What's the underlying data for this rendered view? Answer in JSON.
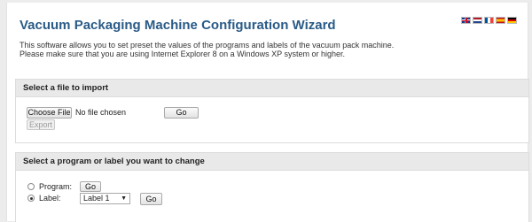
{
  "header": {
    "title": "Vacuum Packaging Machine Configuration Wizard",
    "languages": [
      "English",
      "Dutch",
      "French",
      "Spanish",
      "German"
    ]
  },
  "intro": {
    "line1": "This software allows you to set preset the values of the programs and labels of the vacuum pack machine.",
    "line2": "Please make sure that you are using Internet Explorer 8 on a Windows XP system or higher."
  },
  "import_section": {
    "heading": "Select a file to import",
    "choose_file_label": "Choose File",
    "file_status": "No file chosen",
    "go_label": "Go",
    "export_label": "Export"
  },
  "change_section": {
    "heading": "Select a program or label you want to change",
    "program_label": "Program:",
    "program_go_label": "Go",
    "label_label": "Label:",
    "label_select_value": "Label 1",
    "label_go_label": "Go",
    "selected_option": "Label"
  }
}
